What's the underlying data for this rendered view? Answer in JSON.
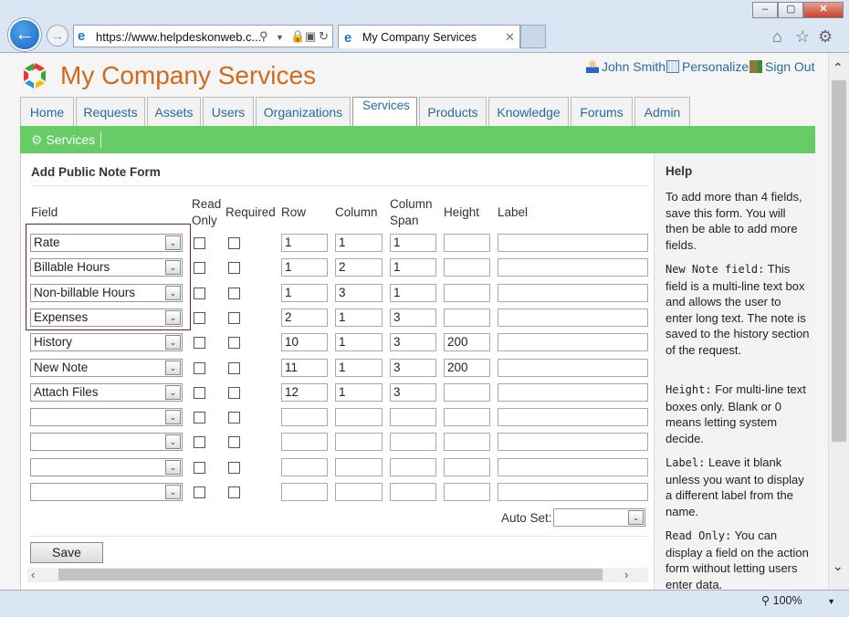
{
  "browser": {
    "url": "https://www.helpdeskonweb.c...",
    "tab_title": "My Company Services",
    "zoom": "100%",
    "window_min": "–",
    "window_max": "▢",
    "window_close": "✕"
  },
  "site": {
    "title": "My Company Services",
    "user_link": "John Smith",
    "personalize_link": "Personalize",
    "signout_link": "Sign Out"
  },
  "nav": {
    "tabs": [
      "Home",
      "Requests",
      "Assets",
      "Users",
      "Organizations",
      "Services",
      "Products",
      "Knowledge",
      "Forums",
      "Admin"
    ],
    "selected": "Services"
  },
  "subnav": {
    "item": "Services"
  },
  "form": {
    "title": "Add Public Note Form",
    "headers": {
      "field": "Field",
      "read_only": [
        "Read",
        "Only"
      ],
      "required": "Required",
      "row": "Row",
      "column": "Column",
      "column_span": [
        "Column",
        "Span"
      ],
      "height": "Height",
      "label": "Label"
    },
    "rows": [
      {
        "field": "Rate",
        "row": "1",
        "column": "1",
        "span": "1",
        "height": ""
      },
      {
        "field": "Billable Hours",
        "row": "1",
        "column": "2",
        "span": "1",
        "height": ""
      },
      {
        "field": "Non-billable Hours",
        "row": "1",
        "column": "3",
        "span": "1",
        "height": ""
      },
      {
        "field": "Expenses",
        "row": "2",
        "column": "1",
        "span": "3",
        "height": ""
      },
      {
        "field": "History",
        "row": "10",
        "column": "1",
        "span": "3",
        "height": "200"
      },
      {
        "field": "New Note",
        "row": "11",
        "column": "1",
        "span": "3",
        "height": "200"
      },
      {
        "field": "Attach Files",
        "row": "12",
        "column": "1",
        "span": "3",
        "height": ""
      },
      {
        "field": "",
        "row": "",
        "column": "",
        "span": "",
        "height": ""
      },
      {
        "field": "",
        "row": "",
        "column": "",
        "span": "",
        "height": ""
      },
      {
        "field": "",
        "row": "",
        "column": "",
        "span": "",
        "height": ""
      },
      {
        "field": "",
        "row": "",
        "column": "",
        "span": "",
        "height": ""
      }
    ],
    "auto_set_label": "Auto Set:",
    "auto_set_value": "",
    "save_label": "Save"
  },
  "help": {
    "title": "Help",
    "p1": "To add more than 4 fields, save this form. You will then be able to add more fields.",
    "p2_term": "New Note field:",
    "p2": "This field is a multi-line text box and allows the user to enter long text. The note is saved to the history section of the request.",
    "p3_term": "Height:",
    "p3": "For multi-line text boxes only. Blank or 0 means letting system decide.",
    "p4_term": "Label:",
    "p4": "Leave it blank unless you want to display a different label from the name.",
    "p5_term": "Read Only:",
    "p5": "You can display a field on the action form without letting users enter data."
  },
  "icons": [
    "back-icon",
    "forward-icon",
    "search-icon",
    "lock-icon",
    "refresh-icon",
    "home-icon",
    "star-icon",
    "gear-icon",
    "user-icon",
    "personalize-icon",
    "signout-icon",
    "services-gear-icon",
    "zoom-icon"
  ]
}
